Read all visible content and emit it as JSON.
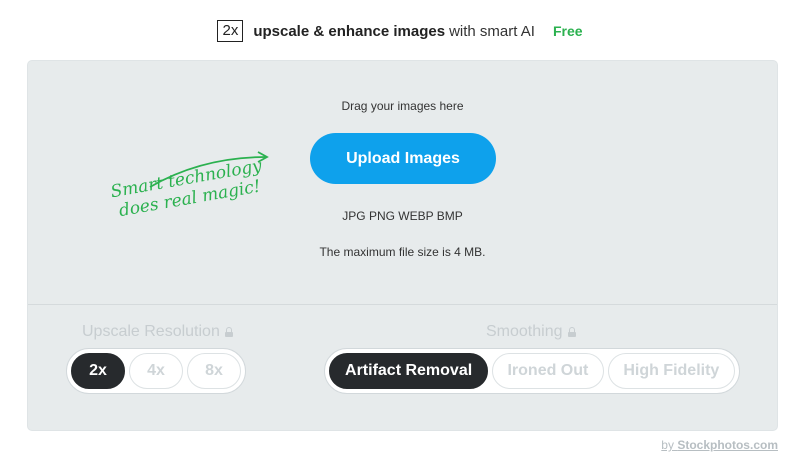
{
  "header": {
    "badge": "2x",
    "title_bold": "upscale & enhance images",
    "title_light": "with smart AI",
    "free": "Free"
  },
  "upload": {
    "drag_text": "Drag your images here",
    "button_label": "Upload Images",
    "formats": "JPG PNG WEBP BMP",
    "max_size": "The maximum file size is 4 MB."
  },
  "tagline": {
    "line1": "Smart technology",
    "line2": "does real magic!"
  },
  "resolution": {
    "label": "Upscale Resolution",
    "options": [
      "2x",
      "4x",
      "8x"
    ],
    "selected": "2x"
  },
  "smoothing": {
    "label": "Smoothing",
    "options": [
      "Artifact Removal",
      "Ironed Out",
      "High Fidelity"
    ],
    "selected": "Artifact Removal"
  },
  "footer": {
    "by": "by",
    "brand": "Stockphotos.com"
  },
  "colors": {
    "accent": "#0ea1ec",
    "free_green": "#2bb14f",
    "active_dark": "#272a2d"
  }
}
